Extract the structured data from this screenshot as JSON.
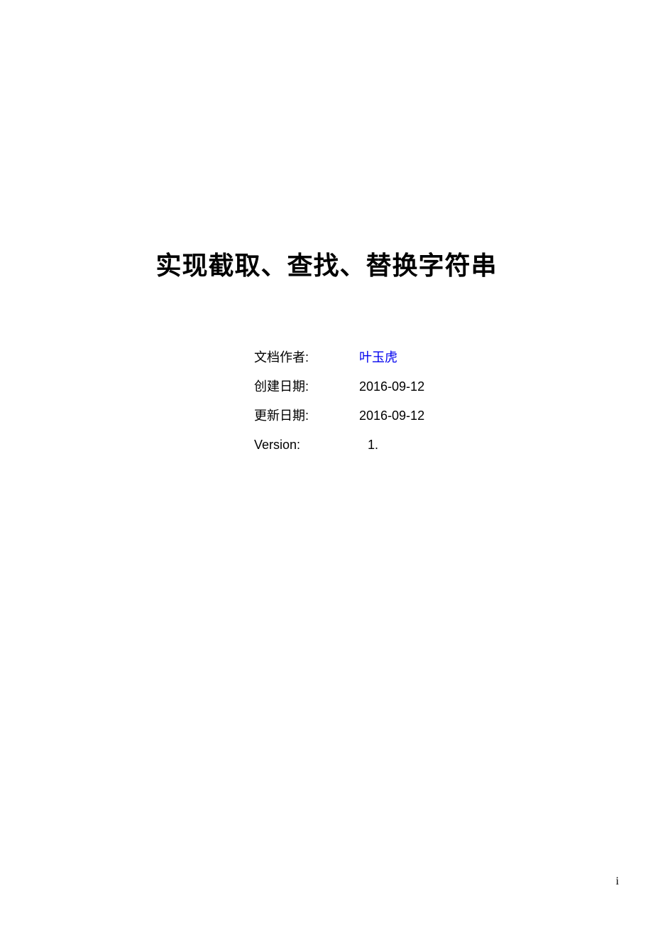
{
  "title": "实现截取、查找、替换字符串",
  "info": {
    "rows": [
      {
        "label": "文档作者:",
        "value": "叶玉虎",
        "link": true,
        "indent": false
      },
      {
        "label": "创建日期:",
        "value": "2016-09-12",
        "link": false,
        "indent": false
      },
      {
        "label": "更新日期:",
        "value": "2016-09-12",
        "link": false,
        "indent": false
      },
      {
        "label": "Version:",
        "value": "1.",
        "link": false,
        "indent": true
      }
    ]
  },
  "pageNum": "i"
}
